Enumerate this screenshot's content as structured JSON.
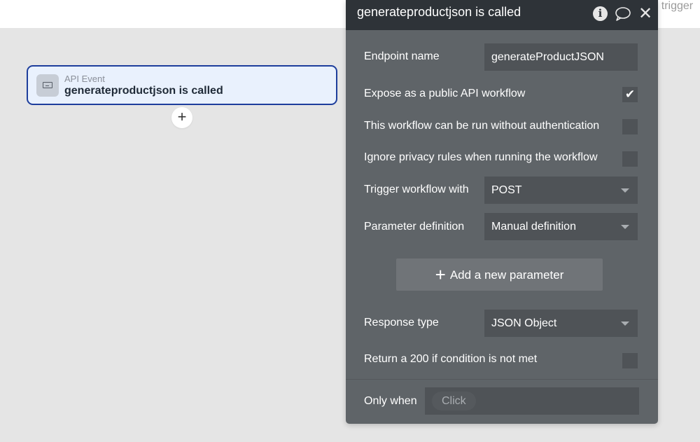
{
  "background": {
    "trigger_fragment": ") trigger"
  },
  "event_card": {
    "type": "API Event",
    "name": "generateproductjson is called"
  },
  "add_step_label": "+",
  "panel": {
    "title": "generateproductjson is called",
    "info_icon": "i",
    "close_icon": "✕",
    "endpoint": {
      "label": "Endpoint name",
      "value": "generateProductJSON"
    },
    "expose": {
      "label": "Expose as a public API workflow",
      "checked": true,
      "check_glyph": "✔"
    },
    "no_auth": {
      "label": "This workflow can be run without authentication",
      "checked": false
    },
    "ignore_privacy": {
      "label": "Ignore privacy rules when running the workflow",
      "checked": false
    },
    "trigger": {
      "label": "Trigger workflow with",
      "value": "POST"
    },
    "param_def": {
      "label": "Parameter definition",
      "value": "Manual definition"
    },
    "add_param": {
      "plus": "+",
      "label": "Add a new parameter"
    },
    "response": {
      "label": "Response type",
      "value": "JSON Object"
    },
    "return200": {
      "label": "Return a 200 if condition is not met",
      "checked": false
    },
    "only_when": {
      "label": "Only when",
      "placeholder": "Click"
    }
  },
  "colors": {
    "canvas": "#e5e5e5",
    "panel": "#5f6468",
    "panel_header": "#2e3338",
    "card_border": "#1e3e9c",
    "card_bg": "#e9f1fd"
  }
}
